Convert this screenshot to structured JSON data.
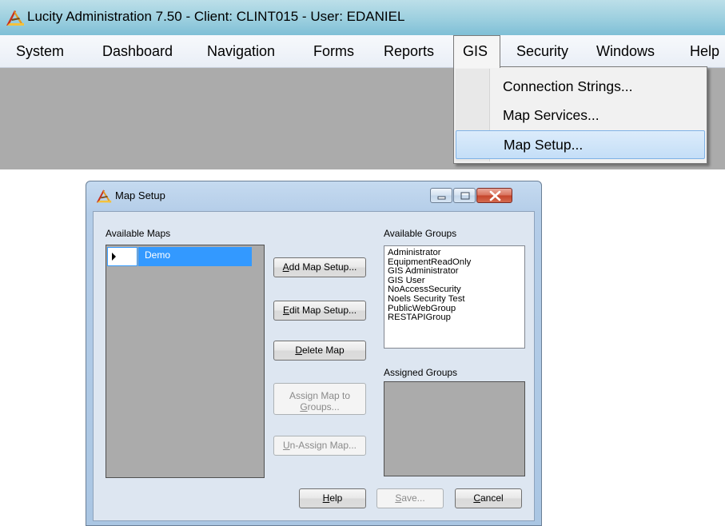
{
  "app": {
    "title": "Lucity Administration 7.50 - Client: CLINT015 - User: EDANIEL",
    "menu": [
      "System",
      "Dashboard",
      "Navigation",
      "Forms",
      "Reports",
      "GIS",
      "Security",
      "Windows",
      "Help"
    ],
    "active_menu": "GIS",
    "gis_menu_items": [
      "Connection Strings...",
      "Map Services...",
      "Map Setup..."
    ],
    "highlighted_item": "Map Setup..."
  },
  "dialog": {
    "title": "Map Setup",
    "available_maps_label": "Available Maps",
    "maps": [
      "Demo"
    ],
    "available_groups_label": "Available Groups",
    "groups": [
      "Administrator",
      "EquipmentReadOnly",
      "GIS Administrator",
      "GIS User",
      "NoAccessSecurity",
      "Noels Security Test",
      "PublicWebGroup",
      "RESTAPIGroup"
    ],
    "assigned_groups_label": "Assigned Groups",
    "buttons": {
      "add": {
        "mnemonic": "A",
        "rest": "dd Map Setup..."
      },
      "edit": {
        "mnemonic": "E",
        "rest": "dit Map Setup..."
      },
      "delete": {
        "mnemonic": "D",
        "rest": "elete Map"
      },
      "assign_line1": "Assign Map to",
      "assign_line2": {
        "mnemonic": "G",
        "rest": "roups..."
      },
      "unassign": {
        "mnemonic": "U",
        "rest": "n-Assign Map..."
      },
      "help": {
        "mnemonic": "H",
        "rest": "elp"
      },
      "save": {
        "mnemonic": "S",
        "rest": "ave..."
      },
      "cancel": {
        "mnemonic": "C",
        "rest": "ancel"
      }
    }
  },
  "colors": {
    "title_gradient_top": "#bcdfe9",
    "app_background": "#ababab",
    "selection_blue": "#3399ff",
    "menu_highlight": "#c4def7"
  }
}
